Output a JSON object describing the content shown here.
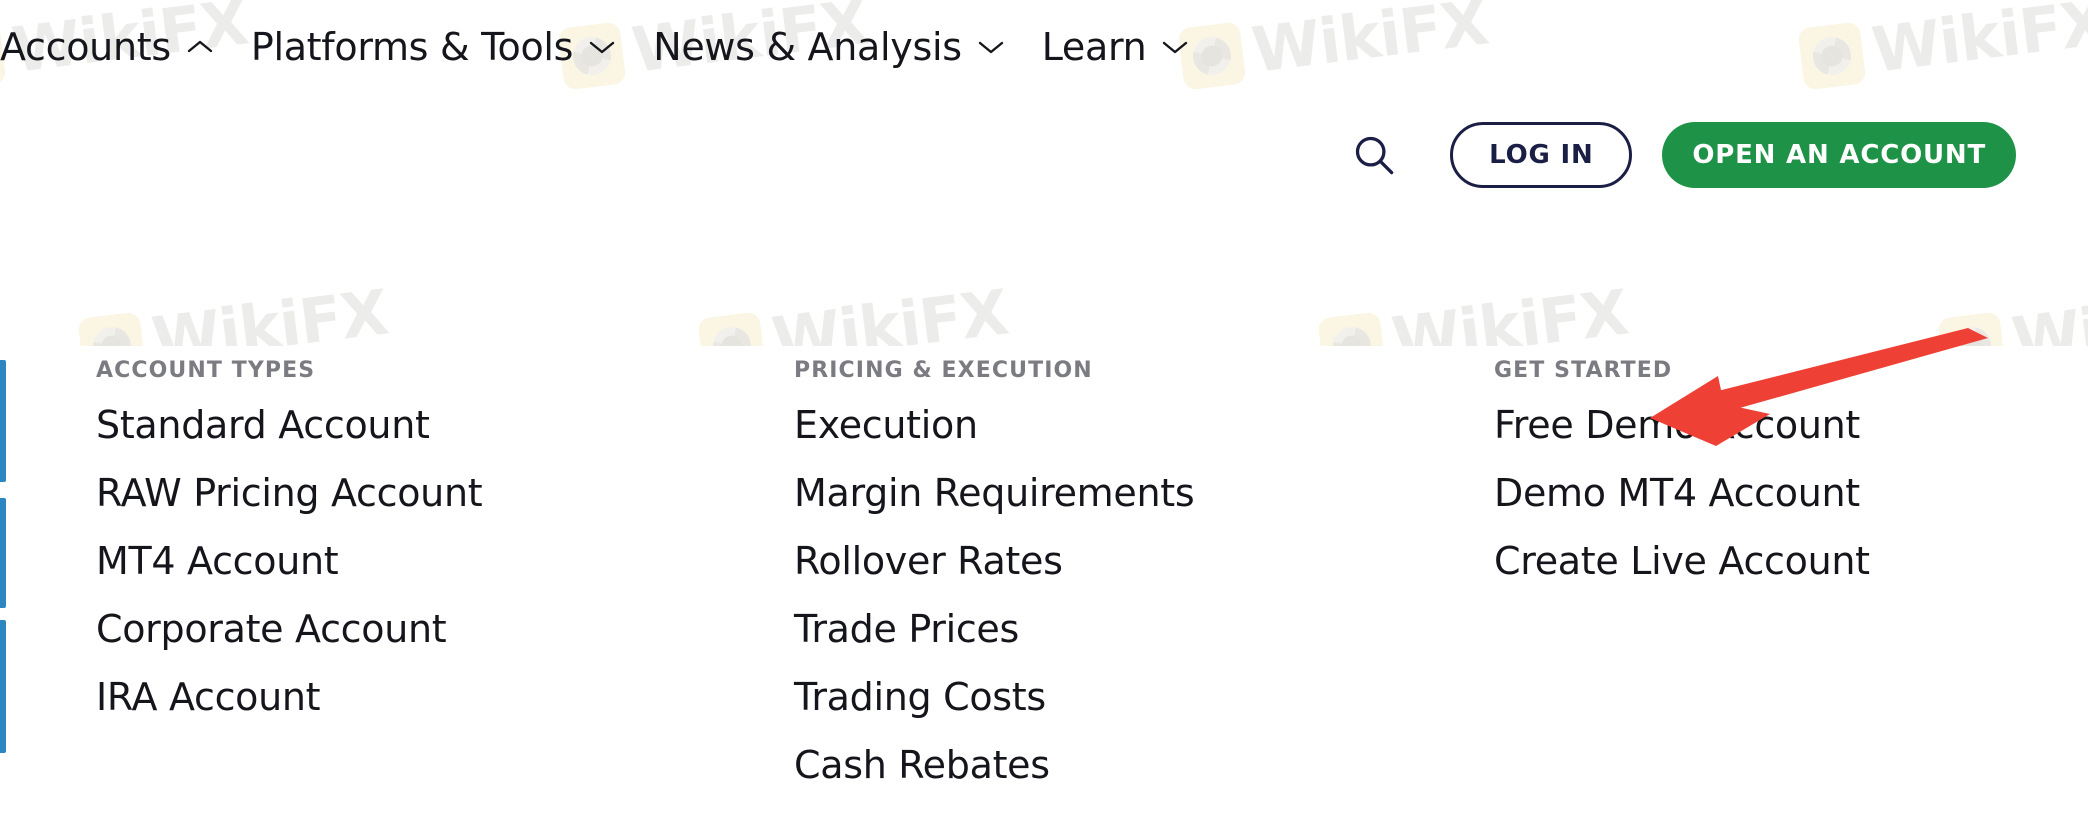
{
  "nav": {
    "items": [
      {
        "label": "Accounts",
        "icon": "chevron-up-icon",
        "expanded": true
      },
      {
        "label": "Platforms & Tools",
        "icon": "chevron-down-icon",
        "expanded": false
      },
      {
        "label": "News & Analysis",
        "icon": "chevron-down-icon",
        "expanded": false
      },
      {
        "label": "Learn",
        "icon": "chevron-down-icon",
        "expanded": false
      }
    ]
  },
  "actions": {
    "search_icon": "search-icon",
    "login_label": "LOG IN",
    "open_account_label": "OPEN AN ACCOUNT"
  },
  "mega_menu": {
    "columns": [
      {
        "heading": "ACCOUNT TYPES",
        "links": [
          "Standard Account",
          "RAW Pricing Account",
          "MT4 Account",
          "Corporate Account",
          "IRA Account"
        ]
      },
      {
        "heading": "PRICING & EXECUTION",
        "links": [
          "Execution",
          "Margin Requirements",
          "Rollover Rates",
          "Trade Prices",
          "Trading Costs",
          "Cash Rebates"
        ]
      },
      {
        "heading": "GET STARTED",
        "links": [
          "Free Demo Account",
          "Demo MT4 Account",
          "Create Live Account"
        ]
      }
    ]
  },
  "annotation": {
    "type": "arrow",
    "color": "#ef4036",
    "points_to": "Free Demo Account"
  },
  "watermark": {
    "text": "WikiFX",
    "logo": "wikifx-logo-icon"
  },
  "colors": {
    "brand_green": "#1e9348",
    "brand_navy": "#1b1f45",
    "text_primary": "#15151c",
    "heading_gray": "#7b7b82",
    "accent_blue": "#2e86c1",
    "annotation_red": "#ef4036",
    "page_background": "#ffffff"
  }
}
